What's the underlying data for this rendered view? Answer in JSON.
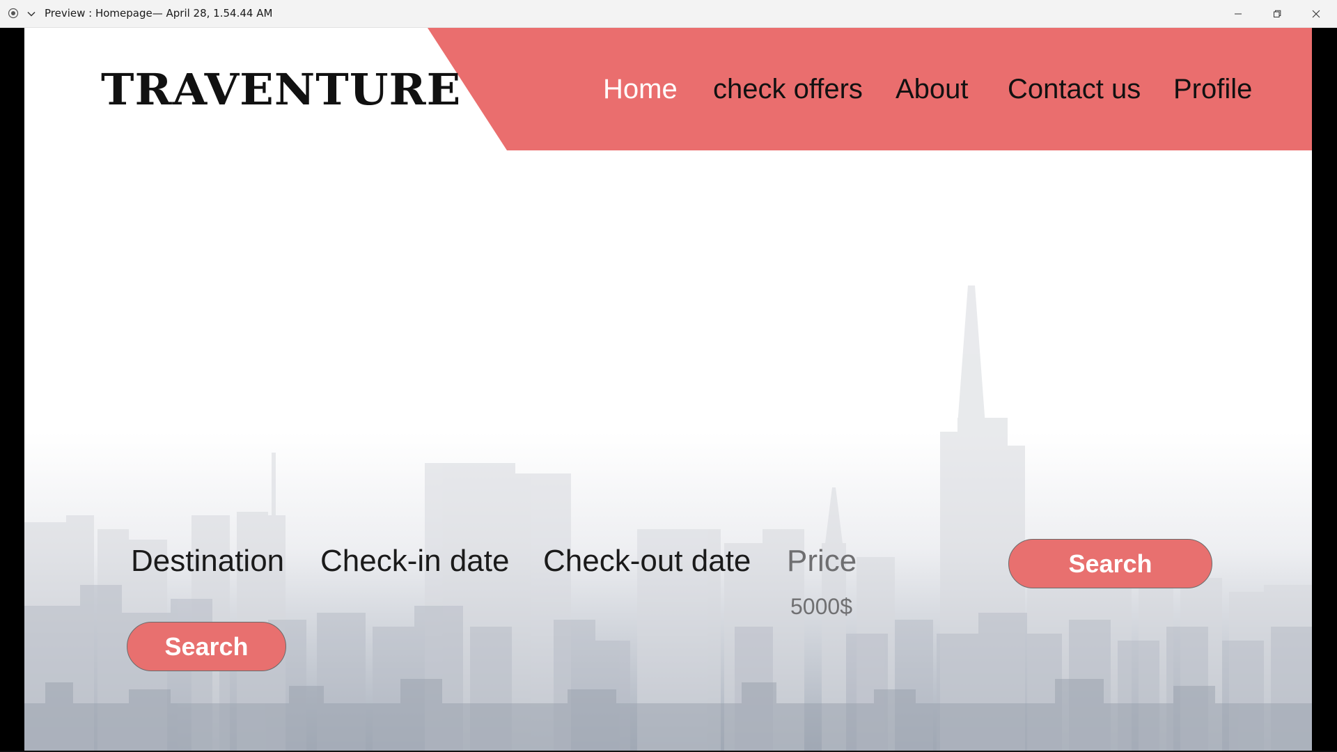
{
  "window": {
    "title": "Preview : Homepage— April 28, 1.54.44 AM",
    "app_icon": "record-circle-icon",
    "menu_icon": "chevron-down-icon",
    "controls": [
      "minimize-icon",
      "restore-icon",
      "close-icon"
    ]
  },
  "site": {
    "logo_text": "TRAVENTURE",
    "accent_color": "#ea6e6e"
  },
  "nav": {
    "items": [
      {
        "label": "Home",
        "active": true
      },
      {
        "label": "check offers",
        "active": false
      },
      {
        "label": "About",
        "active": false
      },
      {
        "label": "Contact us",
        "active": false
      },
      {
        "label": "Profile",
        "active": false
      }
    ]
  },
  "search_form": {
    "destination_label": "Destination",
    "checkin_label": "Check-in date",
    "checkout_label": "Check-out date",
    "price_label": "Price",
    "price_value": "5000$",
    "search_button": "Search",
    "secondary_search_button": "Search"
  },
  "background": {
    "image": "city-skyline-silhouette"
  }
}
